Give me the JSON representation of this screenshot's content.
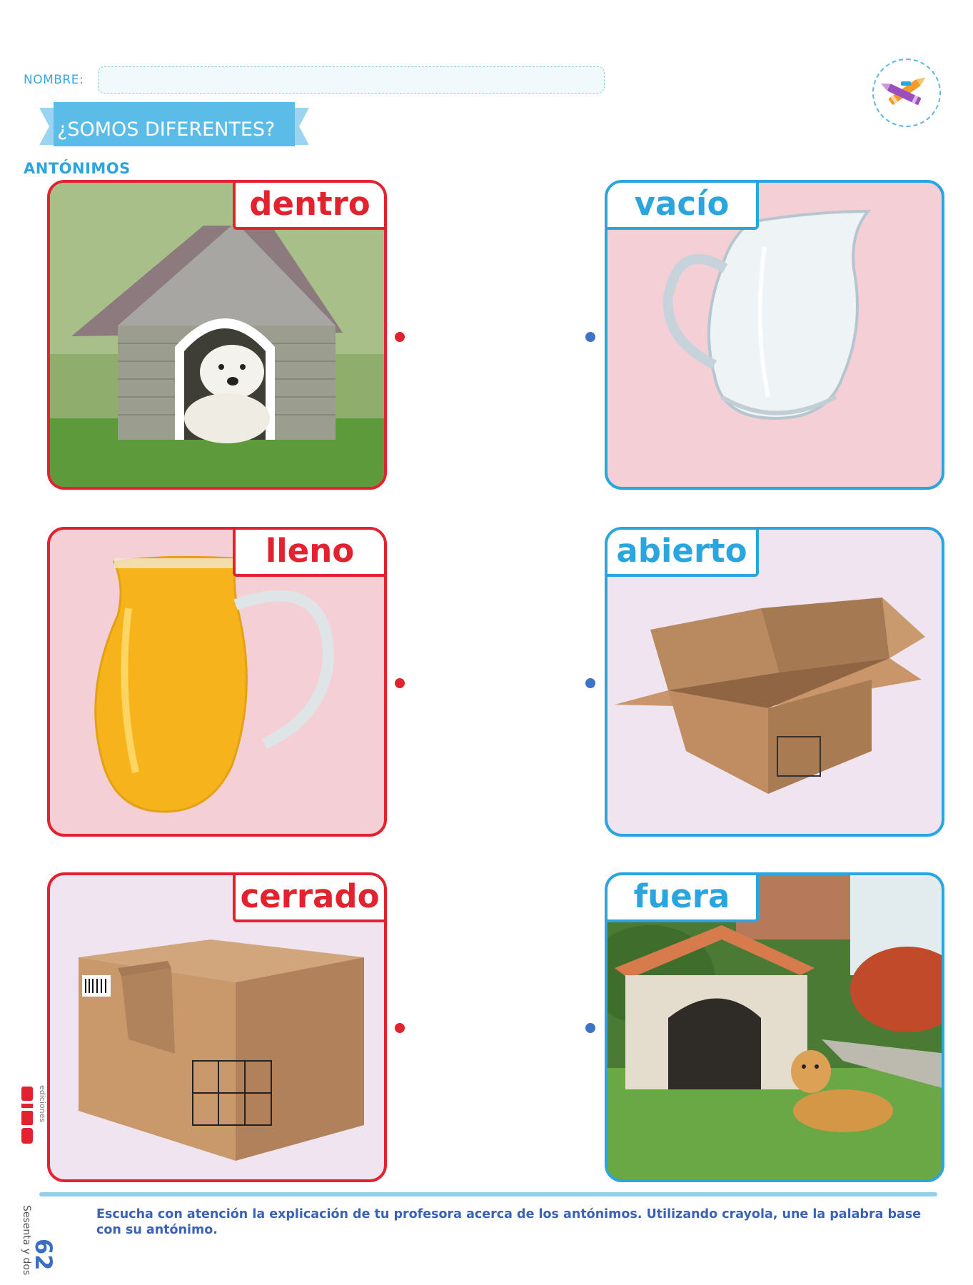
{
  "header": {
    "name_label": "NOMBRE:",
    "title": "¿SOMOS DIFERENTES?",
    "subtitle": "ANTÓNIMOS",
    "badge_icon": "crayons-icon"
  },
  "cards": [
    {
      "word": "dentro",
      "color": "red",
      "picture": "dog inside doghouse",
      "bg": "#d9e8c8"
    },
    {
      "word": "vacío",
      "color": "blue",
      "picture": "empty glass pitcher",
      "bg": "#f5cfd6"
    },
    {
      "word": "lleno",
      "color": "red",
      "picture": "pitcher full of orange juice",
      "bg": "#f5cfd6"
    },
    {
      "word": "abierto",
      "color": "blue",
      "picture": "open cardboard box",
      "bg": "#efe4ef"
    },
    {
      "word": "cerrado",
      "color": "red",
      "picture": "closed cardboard box",
      "bg": "#efe4ef"
    },
    {
      "word": "fuera",
      "color": "blue",
      "picture": "dog outside doghouse",
      "bg": "#cfe3c0"
    }
  ],
  "colors": {
    "red": "#e2222f",
    "blue": "#2aa5dd",
    "dot_blue": "#3f73c4",
    "title_blue": "#2fa3dc"
  },
  "footer": {
    "instructions": "Escucha con atención la explicación de tu profesora acerca de los antónimos. Utilizando crayola, une la palabra base con su antónimo.",
    "page_number": "62",
    "page_words": "Sesenta y dos",
    "logo": "Piza",
    "logo_sub": "ediciones"
  }
}
